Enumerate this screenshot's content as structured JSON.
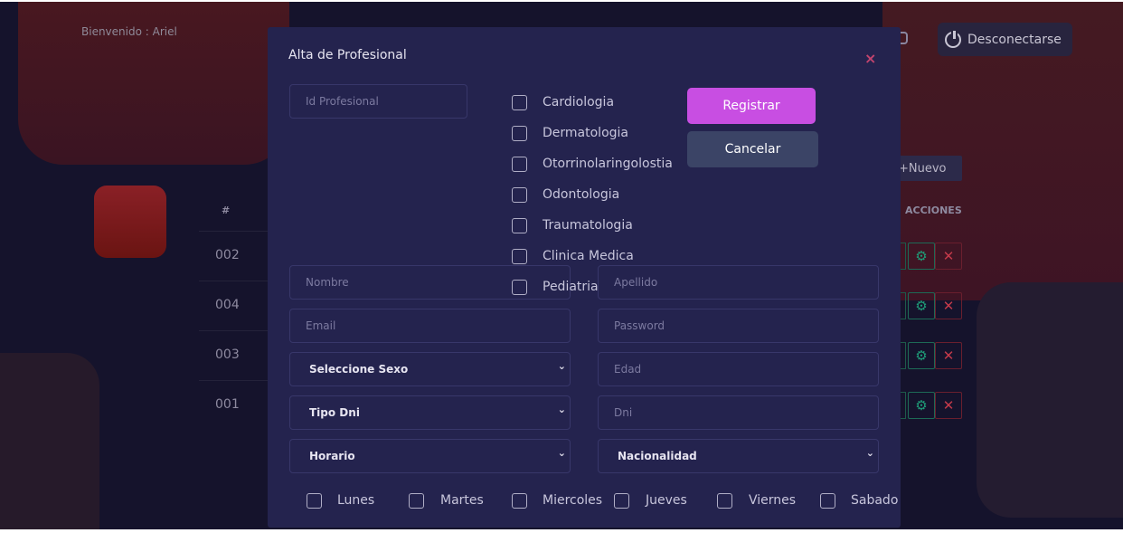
{
  "background": {
    "welcome_text": "Bienvenido : Ariel",
    "logout_label": "Desconectarse",
    "new_button_label": "+Nuevo",
    "table": {
      "header_hash": "#",
      "header_actions": "ACCIONES",
      "rows": [
        "002",
        "004",
        "003",
        "001"
      ]
    },
    "icons": {
      "gear": "⚙",
      "close": "✕"
    }
  },
  "modal": {
    "title": "Alta de Profesional",
    "close_label": "×",
    "id_placeholder": "Id Profesional",
    "specialties": [
      "Cardiologia",
      "Dermatologia",
      "Otorrinolaringolostia",
      "Odontologia",
      "Traumatologia",
      "Clinica Medica",
      "Pediatria"
    ],
    "register_label": "Registrar",
    "cancel_label": "Cancelar",
    "fields": {
      "nombre": "Nombre",
      "apellido": "Apellido",
      "email": "Email",
      "password": "Password",
      "edad": "Edad",
      "dni": "Dni"
    },
    "selects": {
      "sexo": "Seleccione Sexo",
      "tipo_dni": "Tipo Dni",
      "horario": "Horario",
      "nacionalidad": "Nacionalidad",
      "chevron": "⌄"
    },
    "days": [
      "Lunes",
      "Martes",
      "Miercoles",
      "Jueves",
      "Viernes",
      "Sabado"
    ]
  },
  "colors": {
    "background": "#15132c",
    "modal": "#24234e",
    "accent": "#c84ee2",
    "cancel": "#3b4466"
  }
}
